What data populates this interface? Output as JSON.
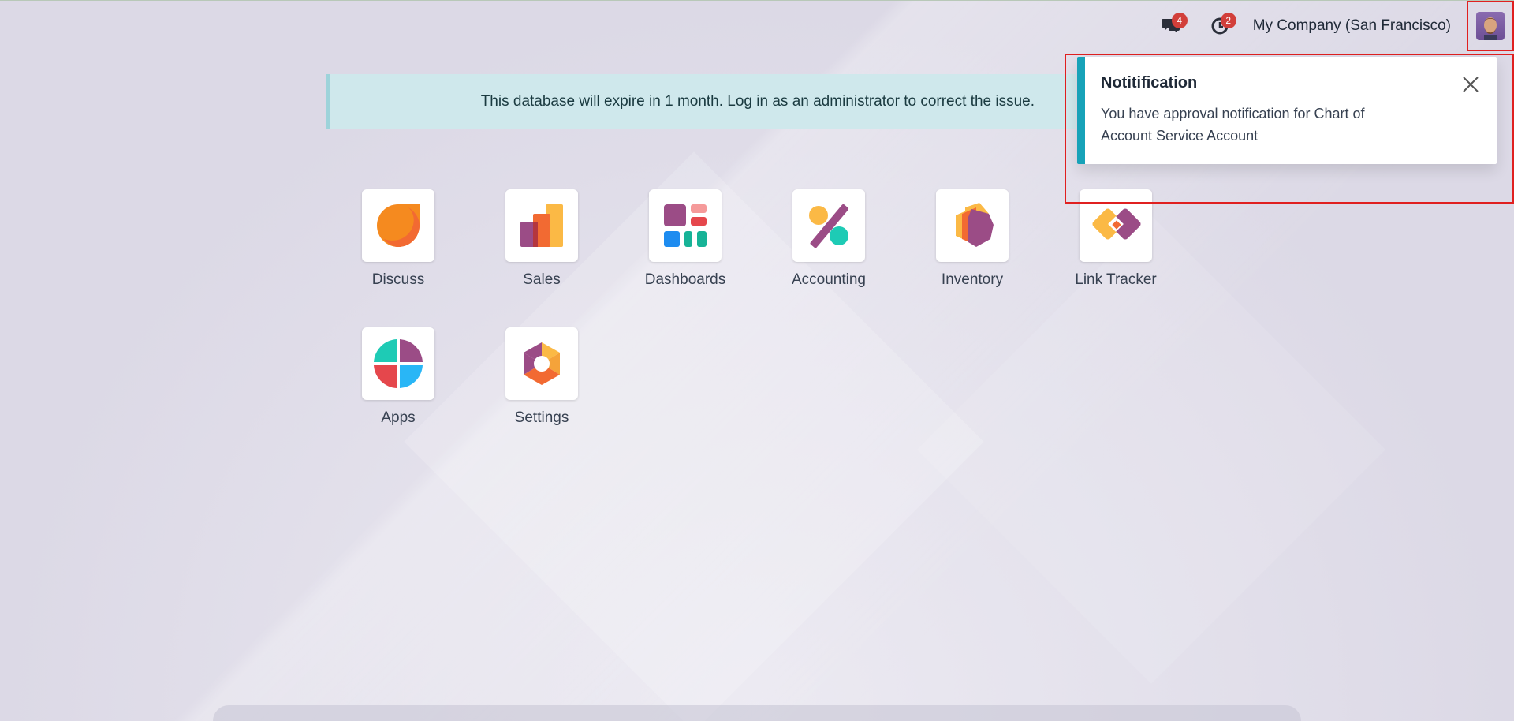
{
  "navbar": {
    "chat_badge": "4",
    "activity_badge": "2",
    "company": "My Company (San Francisco)"
  },
  "alert": {
    "text": "This database will expire in 1 month. Log in as an administrator to correct the issue."
  },
  "apps": [
    {
      "label": "Discuss",
      "icon": "discuss-icon"
    },
    {
      "label": "Sales",
      "icon": "sales-icon"
    },
    {
      "label": "Dashboards",
      "icon": "dashboards-icon"
    },
    {
      "label": "Accounting",
      "icon": "accounting-icon"
    },
    {
      "label": "Inventory",
      "icon": "inventory-icon"
    },
    {
      "label": "Link Tracker",
      "icon": "link-tracker-icon"
    },
    {
      "label": "Apps",
      "icon": "apps-icon"
    },
    {
      "label": "Settings",
      "icon": "settings-icon"
    }
  ],
  "notification": {
    "title": "Notitification",
    "body": "You have approval notification for Chart of Account Service Account"
  },
  "colors": {
    "accent": "#17a2b8",
    "badge": "#d23f3a",
    "highlight": "#e02020"
  }
}
